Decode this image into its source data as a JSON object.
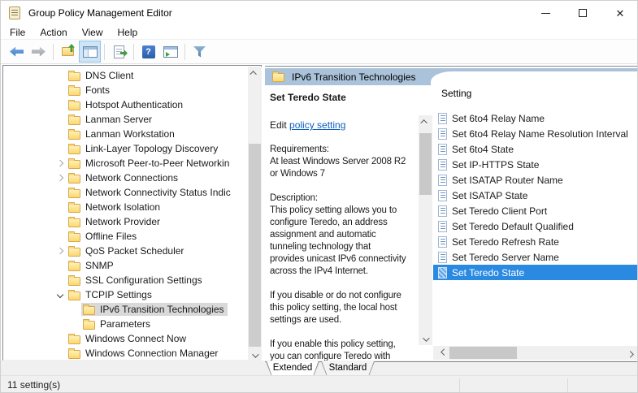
{
  "window": {
    "title": "Group Policy Management Editor"
  },
  "menu": {
    "items": [
      "File",
      "Action",
      "View",
      "Help"
    ]
  },
  "toolbar": {
    "buttons": [
      {
        "name": "back"
      },
      {
        "name": "forward"
      },
      {
        "name": "separator"
      },
      {
        "name": "up-one-level"
      },
      {
        "name": "show-console-tree",
        "active": true
      },
      {
        "name": "separator"
      },
      {
        "name": "export-list"
      },
      {
        "name": "separator"
      },
      {
        "name": "help"
      },
      {
        "name": "show-actions-pane"
      },
      {
        "name": "separator"
      },
      {
        "name": "filter"
      }
    ]
  },
  "tree": {
    "items": [
      {
        "label": "DNS Client",
        "indent": 0,
        "chevron": "none",
        "selected": false
      },
      {
        "label": "Fonts",
        "indent": 0,
        "chevron": "none",
        "selected": false
      },
      {
        "label": "Hotspot Authentication",
        "indent": 0,
        "chevron": "none",
        "selected": false
      },
      {
        "label": "Lanman Server",
        "indent": 0,
        "chevron": "none",
        "selected": false
      },
      {
        "label": "Lanman Workstation",
        "indent": 0,
        "chevron": "none",
        "selected": false
      },
      {
        "label": "Link-Layer Topology Discovery",
        "indent": 0,
        "chevron": "none",
        "selected": false
      },
      {
        "label": "Microsoft Peer-to-Peer Networkin",
        "indent": 0,
        "chevron": "collapsed",
        "selected": false
      },
      {
        "label": "Network Connections",
        "indent": 0,
        "chevron": "collapsed",
        "selected": false
      },
      {
        "label": "Network Connectivity Status Indic",
        "indent": 0,
        "chevron": "none",
        "selected": false
      },
      {
        "label": "Network Isolation",
        "indent": 0,
        "chevron": "none",
        "selected": false
      },
      {
        "label": "Network Provider",
        "indent": 0,
        "chevron": "none",
        "selected": false
      },
      {
        "label": "Offline Files",
        "indent": 0,
        "chevron": "none",
        "selected": false
      },
      {
        "label": "QoS Packet Scheduler",
        "indent": 0,
        "chevron": "collapsed",
        "selected": false
      },
      {
        "label": "SNMP",
        "indent": 0,
        "chevron": "none",
        "selected": false
      },
      {
        "label": "SSL Configuration Settings",
        "indent": 0,
        "chevron": "none",
        "selected": false
      },
      {
        "label": "TCPIP Settings",
        "indent": 0,
        "chevron": "expanded",
        "selected": false
      },
      {
        "label": "IPv6 Transition Technologies",
        "indent": 1,
        "chevron": "none",
        "selected": true
      },
      {
        "label": "Parameters",
        "indent": 1,
        "chevron": "none",
        "selected": false
      },
      {
        "label": "Windows Connect Now",
        "indent": 0,
        "chevron": "none",
        "selected": false
      },
      {
        "label": "Windows Connection Manager",
        "indent": 0,
        "chevron": "none",
        "selected": false
      }
    ]
  },
  "results": {
    "header_title": "IPv6 Transition Technologies",
    "detail": {
      "title": "Set Teredo State",
      "edit_label": "Edit",
      "edit_link": "policy setting",
      "blocks": [
        [
          "Requirements:",
          "At least Windows Server 2008 R2",
          "or Windows 7"
        ],
        [
          "Description:",
          "This policy setting allows you to",
          "configure Teredo, an address",
          "assignment and automatic",
          "tunneling technology that",
          "provides unicast IPv6 connectivity",
          "across the IPv4 Internet."
        ],
        [
          "If you disable or do not configure",
          "this policy setting, the local host",
          "settings are used."
        ],
        [
          "If you enable this policy setting,",
          "you can configure Teredo with"
        ]
      ]
    },
    "list": {
      "column_header": "Setting",
      "items": [
        "Set 6to4 Relay Name",
        "Set 6to4 Relay Name Resolution Interval",
        "Set 6to4 State",
        "Set IP-HTTPS State",
        "Set ISATAP Router Name",
        "Set ISATAP State",
        "Set Teredo Client Port",
        "Set Teredo Default Qualified",
        "Set Teredo Refresh Rate",
        "Set Teredo Server Name",
        "Set Teredo State"
      ],
      "selected_index": 10
    },
    "tabs": [
      {
        "label": "Extended",
        "active": true
      },
      {
        "label": "Standard",
        "active": false
      }
    ]
  },
  "status": {
    "text": "11 setting(s)"
  },
  "colors": {
    "selection_blue": "#2a8ae2",
    "inactive_selection_gray": "#d9d9d9",
    "header_blue": "#abc3da",
    "link_blue": "#0b5fbe"
  }
}
